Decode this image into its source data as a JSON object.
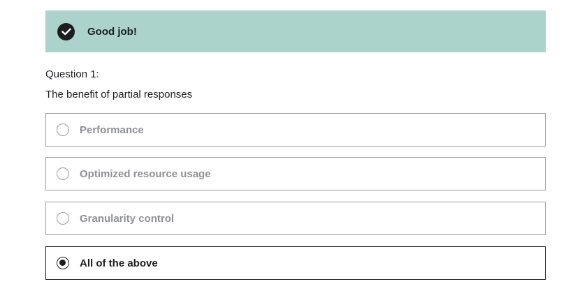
{
  "feedback": {
    "icon": "check-circle-icon",
    "message": "Good job!",
    "background_color": "#acd2cc"
  },
  "question": {
    "number_label": "Question 1:",
    "text": "The benefit of partial responses"
  },
  "options": [
    {
      "label": "Performance",
      "selected": false
    },
    {
      "label": "Optimized resource usage",
      "selected": false
    },
    {
      "label": "Granularity control",
      "selected": false
    },
    {
      "label": "All of the above",
      "selected": true
    }
  ]
}
